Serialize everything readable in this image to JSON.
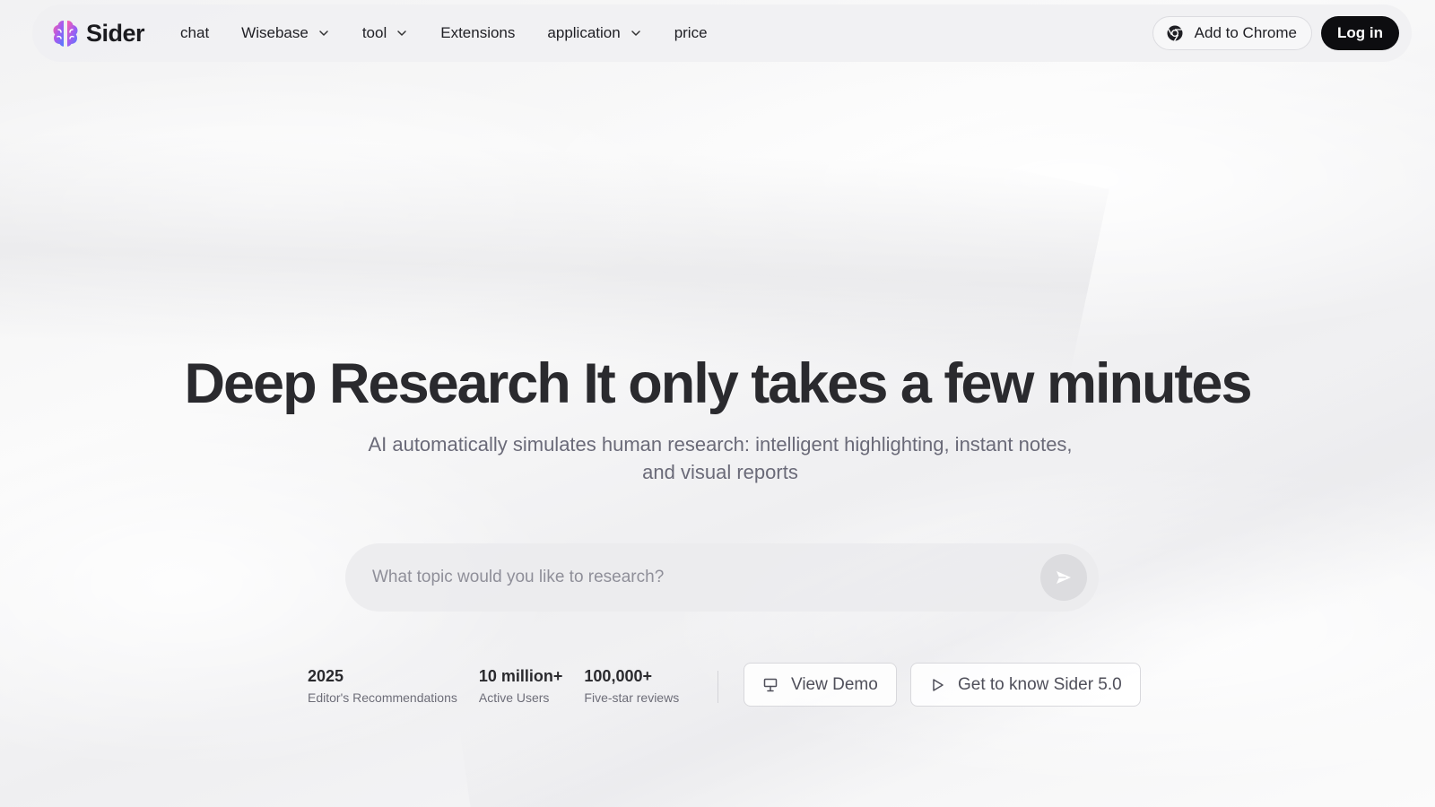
{
  "header": {
    "brand": "Sider",
    "nav": [
      {
        "label": "chat",
        "dropdown": false,
        "name": "nav-chat"
      },
      {
        "label": "Wisebase",
        "dropdown": true,
        "name": "nav-wisebase"
      },
      {
        "label": "tool",
        "dropdown": true,
        "name": "nav-tool"
      },
      {
        "label": "Extensions",
        "dropdown": false,
        "name": "nav-extensions"
      },
      {
        "label": "application",
        "dropdown": true,
        "name": "nav-application"
      },
      {
        "label": "price",
        "dropdown": false,
        "name": "nav-price"
      }
    ],
    "add_to_chrome": "Add to Chrome",
    "login": "Log in"
  },
  "hero": {
    "title": "Deep Research It only takes a few minutes",
    "subtitle": "AI automatically simulates human research: intelligent highlighting, instant notes, and visual reports"
  },
  "search": {
    "placeholder": "What topic would you like to research?",
    "value": ""
  },
  "stats": [
    {
      "value": "2025",
      "label": "Editor's Recommendations"
    },
    {
      "value": "10 million+",
      "label": "Active Users"
    },
    {
      "value": "100,000+",
      "label": "Five-star reviews"
    }
  ],
  "actions": {
    "view_demo": "View Demo",
    "know_sider": "Get to know Sider 5.0"
  },
  "icons": {
    "logo": "sider-brain-logo",
    "chrome": "chrome-icon",
    "send": "send-icon",
    "demo": "presentation-icon",
    "play": "play-icon",
    "chevron": "chevron-down-icon"
  },
  "colors": {
    "login_bg": "#0d0d10",
    "title": "#2a2a2e",
    "subtitle": "#6a6a78"
  }
}
